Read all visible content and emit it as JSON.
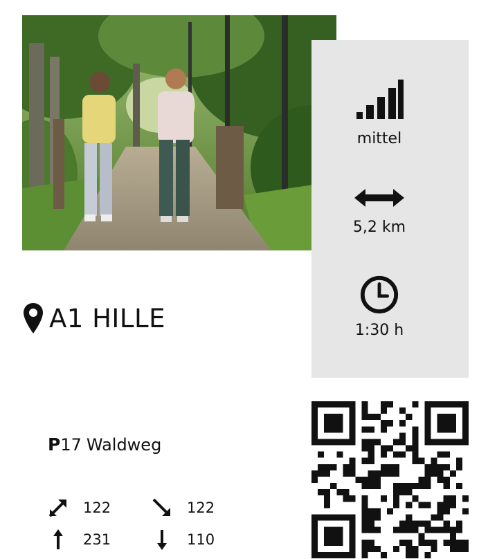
{
  "route": {
    "title": "A1 HILLE"
  },
  "metrics": {
    "difficulty": "mittel",
    "distance": "5,2 km",
    "duration": "1:30 h"
  },
  "parking": {
    "letter": "P",
    "number": "17",
    "name": "Waldweg"
  },
  "stats": {
    "ascent_total": "122",
    "descent_total": "122",
    "max_altitude": "231",
    "min_altitude": "110"
  },
  "colors": {
    "panel": "#e6e6e6",
    "text": "#111111"
  },
  "icons": {
    "difficulty": "signal-bars-icon",
    "distance": "double-arrow-icon",
    "duration": "clock-icon",
    "location": "map-pin-icon",
    "ascent": "diagonal-up-arrow-icon",
    "descent": "diagonal-down-arrow-icon",
    "highest": "up-arrow-icon",
    "lowest": "down-arrow-icon"
  }
}
